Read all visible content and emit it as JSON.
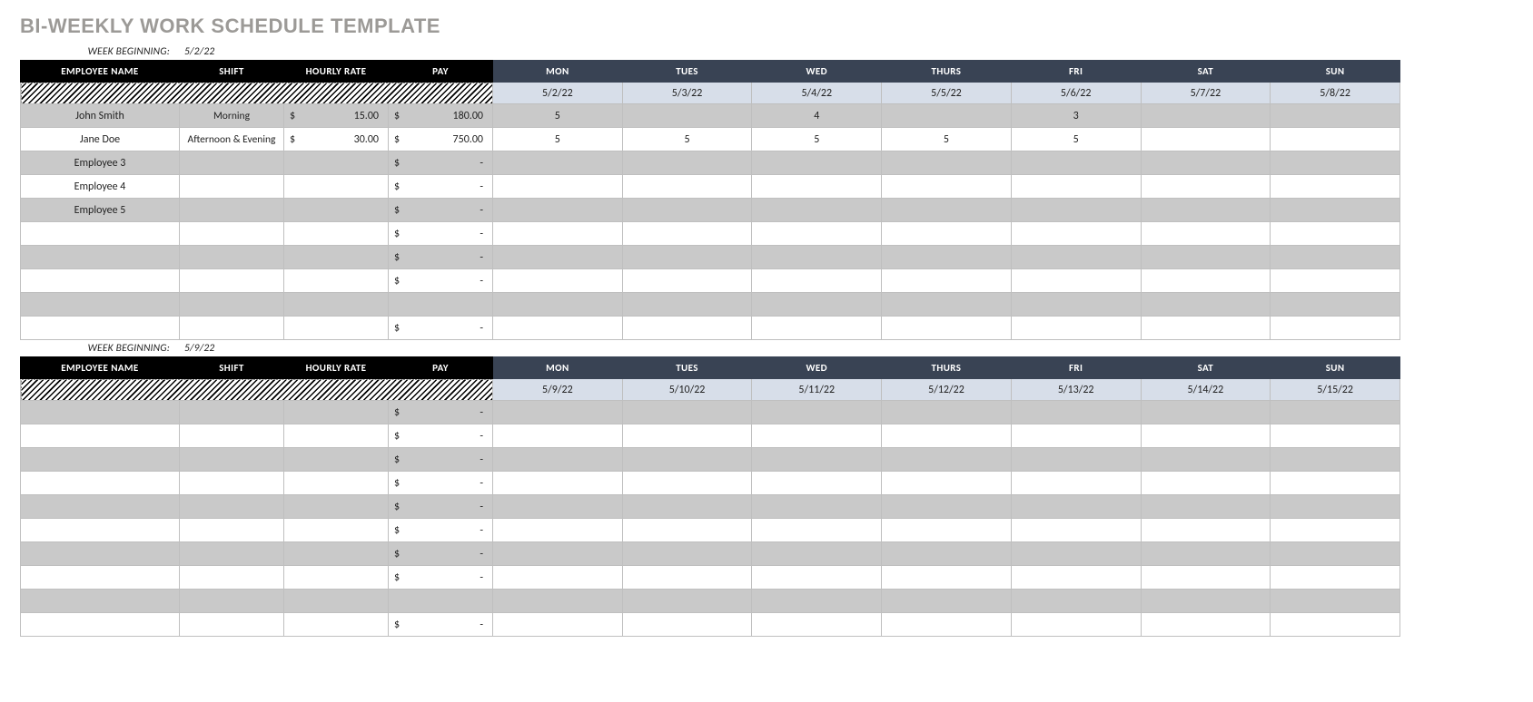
{
  "title": "BI-WEEKLY WORK SCHEDULE TEMPLATE",
  "weekBeginningLabel": "WEEK BEGINNING:",
  "headers": {
    "name": "EMPLOYEE NAME",
    "shift": "SHIFT",
    "rate": "HOURLY RATE",
    "pay": "PAY",
    "days": [
      "MON",
      "TUES",
      "WED",
      "THURS",
      "FRI",
      "SAT",
      "SUN"
    ]
  },
  "weeks": [
    {
      "beginning": "5/2/22",
      "dates": [
        "5/2/22",
        "5/3/22",
        "5/4/22",
        "5/5/22",
        "5/6/22",
        "5/7/22",
        "5/8/22"
      ],
      "rows": [
        {
          "name": "John Smith",
          "shift": "Morning",
          "rate": "15.00",
          "pay": "180.00",
          "days": [
            "5",
            "",
            "4",
            "",
            "3",
            "",
            ""
          ]
        },
        {
          "name": "Jane Doe",
          "shift": "Afternoon & Evening",
          "rate": "30.00",
          "pay": "750.00",
          "days": [
            "5",
            "5",
            "5",
            "5",
            "5",
            "",
            ""
          ]
        },
        {
          "name": "Employee 3",
          "shift": "",
          "rate": "",
          "pay": "-",
          "days": [
            "",
            "",
            "",
            "",
            "",
            "",
            ""
          ]
        },
        {
          "name": "Employee 4",
          "shift": "",
          "rate": "",
          "pay": "-",
          "days": [
            "",
            "",
            "",
            "",
            "",
            "",
            ""
          ]
        },
        {
          "name": "Employee 5",
          "shift": "",
          "rate": "",
          "pay": "-",
          "days": [
            "",
            "",
            "",
            "",
            "",
            "",
            ""
          ]
        },
        {
          "name": "",
          "shift": "",
          "rate": "",
          "pay": "-",
          "days": [
            "",
            "",
            "",
            "",
            "",
            "",
            ""
          ]
        },
        {
          "name": "",
          "shift": "",
          "rate": "",
          "pay": "-",
          "days": [
            "",
            "",
            "",
            "",
            "",
            "",
            ""
          ]
        },
        {
          "name": "",
          "shift": "",
          "rate": "",
          "pay": "-",
          "days": [
            "",
            "",
            "",
            "",
            "",
            "",
            ""
          ]
        },
        {
          "name": "",
          "shift": "",
          "rate": "",
          "pay": "",
          "days": [
            "",
            "",
            "",
            "",
            "",
            "",
            ""
          ]
        },
        {
          "name": "",
          "shift": "",
          "rate": "",
          "pay": "-",
          "days": [
            "",
            "",
            "",
            "",
            "",
            "",
            ""
          ]
        }
      ]
    },
    {
      "beginning": "5/9/22",
      "dates": [
        "5/9/22",
        "5/10/22",
        "5/11/22",
        "5/12/22",
        "5/13/22",
        "5/14/22",
        "5/15/22"
      ],
      "rows": [
        {
          "name": "",
          "shift": "",
          "rate": "",
          "pay": "-",
          "days": [
            "",
            "",
            "",
            "",
            "",
            "",
            ""
          ]
        },
        {
          "name": "",
          "shift": "",
          "rate": "",
          "pay": "-",
          "days": [
            "",
            "",
            "",
            "",
            "",
            "",
            ""
          ]
        },
        {
          "name": "",
          "shift": "",
          "rate": "",
          "pay": "-",
          "days": [
            "",
            "",
            "",
            "",
            "",
            "",
            ""
          ]
        },
        {
          "name": "",
          "shift": "",
          "rate": "",
          "pay": "-",
          "days": [
            "",
            "",
            "",
            "",
            "",
            "",
            ""
          ]
        },
        {
          "name": "",
          "shift": "",
          "rate": "",
          "pay": "-",
          "days": [
            "",
            "",
            "",
            "",
            "",
            "",
            ""
          ]
        },
        {
          "name": "",
          "shift": "",
          "rate": "",
          "pay": "-",
          "days": [
            "",
            "",
            "",
            "",
            "",
            "",
            ""
          ]
        },
        {
          "name": "",
          "shift": "",
          "rate": "",
          "pay": "-",
          "days": [
            "",
            "",
            "",
            "",
            "",
            "",
            ""
          ]
        },
        {
          "name": "",
          "shift": "",
          "rate": "",
          "pay": "-",
          "days": [
            "",
            "",
            "",
            "",
            "",
            "",
            ""
          ]
        },
        {
          "name": "",
          "shift": "",
          "rate": "",
          "pay": "",
          "days": [
            "",
            "",
            "",
            "",
            "",
            "",
            ""
          ]
        },
        {
          "name": "",
          "shift": "",
          "rate": "",
          "pay": "-",
          "days": [
            "",
            "",
            "",
            "",
            "",
            "",
            ""
          ]
        }
      ]
    }
  ]
}
